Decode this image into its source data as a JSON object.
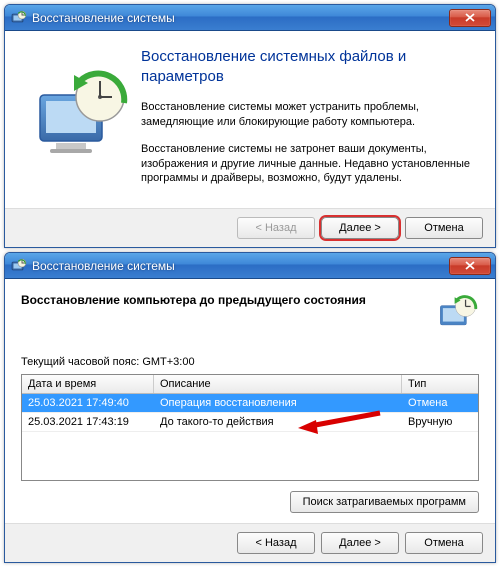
{
  "window1": {
    "title": "Восстановление системы",
    "heading": "Восстановление системных файлов и параметров",
    "para1": "Восстановление системы может устранить проблемы, замедляющие или блокирующие работу компьютера.",
    "para2": "Восстановление системы не затронет ваши документы, изображения и другие личные данные. Недавно установленные программы и драйверы, возможно, будут удалены.",
    "btn_back": "< Назад",
    "btn_next": "Далее >",
    "btn_cancel": "Отмена"
  },
  "window2": {
    "title": "Восстановление системы",
    "heading": "Восстановление компьютера до предыдущего состояния",
    "timezone": "Текущий часовой пояс: GMT+3:00",
    "cols": {
      "date": "Дата и время",
      "desc": "Описание",
      "type": "Тип"
    },
    "rows": [
      {
        "date": "25.03.2021 17:49:40",
        "desc": "Операция восстановления",
        "type": "Отмена",
        "selected": true
      },
      {
        "date": "25.03.2021 17:43:19",
        "desc": "До такого-то действия",
        "type": "Вручную",
        "selected": false
      }
    ],
    "btn_affected": "Поиск затрагиваемых программ",
    "btn_back": "< Назад",
    "btn_next": "Далее >",
    "btn_cancel": "Отмена"
  }
}
